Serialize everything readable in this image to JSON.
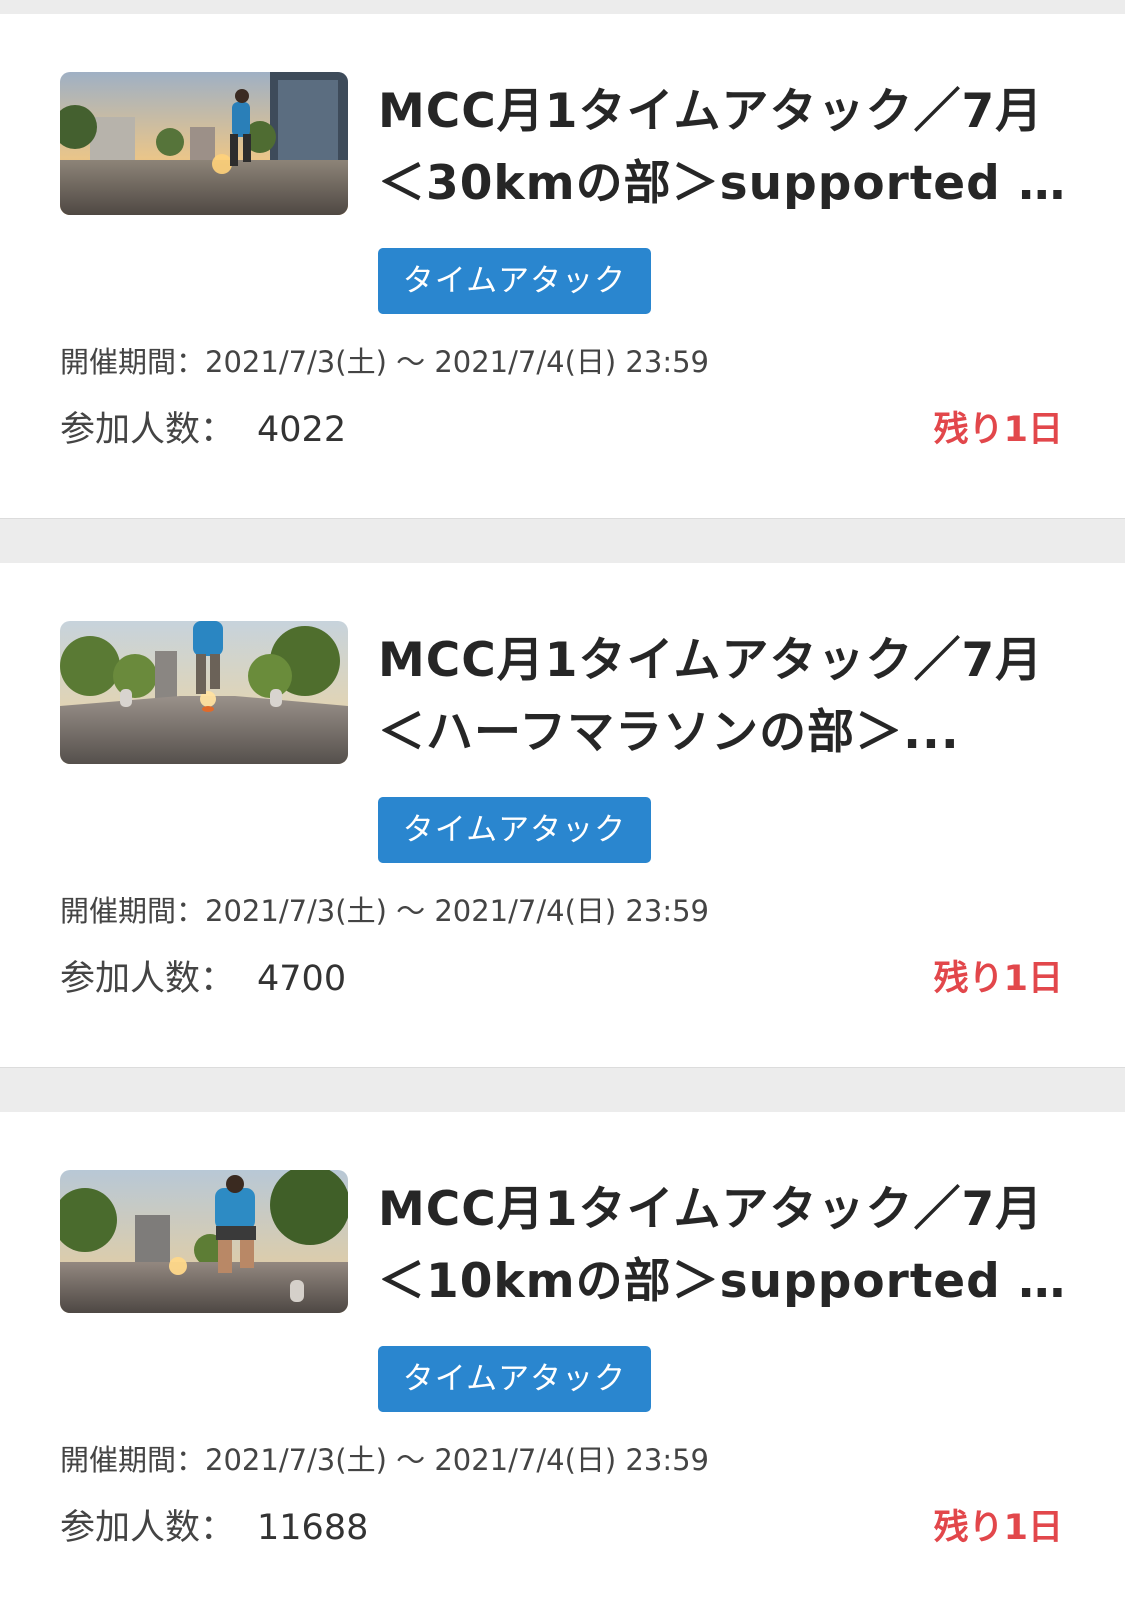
{
  "events": [
    {
      "title_line1": "MCC月1タイムアタック／7月",
      "title_line2": "＜30kmの部＞supported b...",
      "tag": "タイムアタック",
      "period_label": "開催期間：",
      "period_value": "2021/7/3(土) 〜 2021/7/4(日) 23:59",
      "participants_label": "参加人数：",
      "participants_count": "4022",
      "remaining": "残り1日",
      "thumbnail": "runner-photo"
    },
    {
      "title_line1": "MCC月1タイムアタック／7月",
      "title_line2": "＜ハーフマラソンの部＞...",
      "tag": "タイムアタック",
      "period_label": "開催期間：",
      "period_value": "2021/7/3(土) 〜 2021/7/4(日) 23:59",
      "participants_label": "参加人数：",
      "participants_count": "4700",
      "remaining": "残り1日",
      "thumbnail": "runner-photo"
    },
    {
      "title_line1": "MCC月1タイムアタック／7月",
      "title_line2": "＜10kmの部＞supported b...",
      "tag": "タイムアタック",
      "period_label": "開催期間：",
      "period_value": "2021/7/3(土) 〜 2021/7/4(日) 23:59",
      "participants_label": "参加人数：",
      "participants_count": "11688",
      "remaining": "残り1日",
      "thumbnail": "runner-photo"
    }
  ],
  "colors": {
    "tag_background": "#2a86cf",
    "remaining_text": "#e2474b",
    "page_background": "#ececec"
  }
}
